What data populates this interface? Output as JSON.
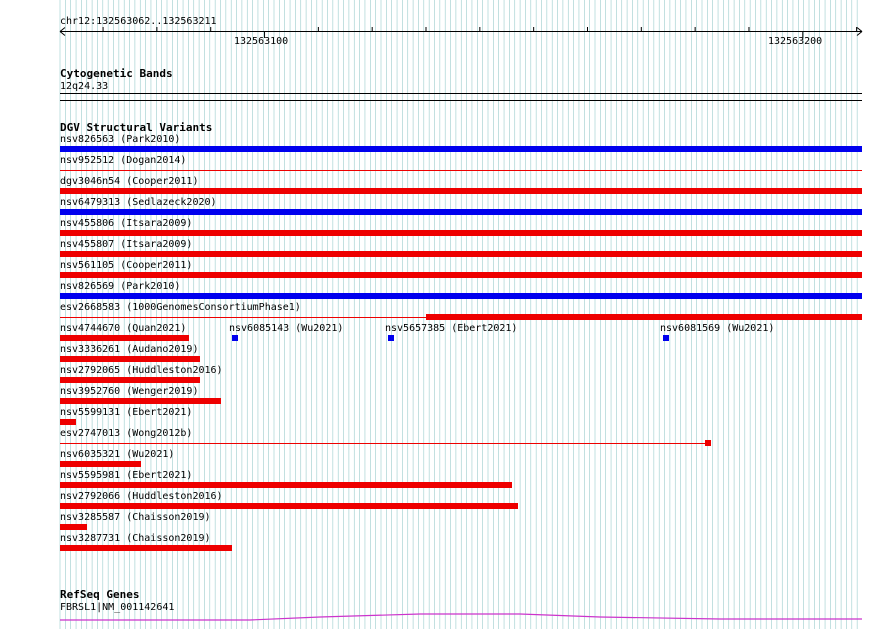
{
  "ruler": {
    "location": "chr12:132563062..132563211",
    "ticks": [
      "132563100",
      "132563200"
    ],
    "start": 132563062,
    "end": 132563211
  },
  "tracks": {
    "cytoband": {
      "title": "Cytogenetic Bands",
      "band": "12q24.33"
    },
    "dgv": {
      "title": "DGV Structural Variants"
    },
    "refseq": {
      "title": "RefSeq Genes",
      "gene": "FBRSL1|NM_001142641"
    }
  },
  "colors": {
    "gain": "#0000ee",
    "loss": "#ee0000",
    "grid": "#99cccc",
    "gene": "#cc33cc"
  },
  "variants": [
    {
      "id": "nsv826563",
      "label": "nsv826563 (Park2010)",
      "color": "gain",
      "start": 132563062,
      "end": 132563211,
      "style": "thick"
    },
    {
      "id": "nsv952512",
      "label": "nsv952512 (Dogan2014)",
      "color": "loss",
      "start": 132563062,
      "end": 132563211,
      "style": "thin"
    },
    {
      "id": "dgv3046n54",
      "label": "dgv3046n54 (Cooper2011)",
      "color": "loss",
      "start": 132563062,
      "end": 132563211,
      "style": "thick"
    },
    {
      "id": "nsv6479313",
      "label": "nsv6479313 (Sedlazeck2020)",
      "color": "gain",
      "start": 132563062,
      "end": 132563211,
      "style": "thick"
    },
    {
      "id": "nsv455806",
      "label": "nsv455806 (Itsara2009)",
      "color": "loss",
      "start": 132563062,
      "end": 132563211,
      "style": "thick"
    },
    {
      "id": "nsv455807",
      "label": "nsv455807 (Itsara2009)",
      "color": "loss",
      "start": 132563062,
      "end": 132563211,
      "style": "thick"
    },
    {
      "id": "nsv561105",
      "label": "nsv561105 (Cooper2011)",
      "color": "loss",
      "start": 132563062,
      "end": 132563211,
      "style": "thick"
    },
    {
      "id": "nsv826569",
      "label": "nsv826569 (Park2010)",
      "color": "gain",
      "start": 132563062,
      "end": 132563211,
      "style": "thick"
    },
    {
      "id": "esv2668583",
      "label": "esv2668583 (1000GenomesConsortiumPhase1)",
      "color": "loss",
      "start": 132563062,
      "end": 132563211,
      "style": "thin-then-thick",
      "thick_start": 132563130
    },
    {
      "id": "nsv4744670",
      "label": "nsv4744670 (Quan2021)",
      "color": "loss",
      "start": 132563062,
      "end": 132563086,
      "style": "thick"
    },
    {
      "id": "nsv6085143",
      "label": "nsv6085143 (Wu2021)",
      "color": "gain",
      "start": 132563094,
      "end": 132563095,
      "style": "dot"
    },
    {
      "id": "nsv5657385",
      "label": "nsv5657385 (Ebert2021)",
      "color": "gain",
      "start": 132563123,
      "end": 132563124,
      "style": "dot"
    },
    {
      "id": "nsv6081569",
      "label": "nsv6081569 (Wu2021)",
      "color": "gain",
      "start": 132563174,
      "end": 132563175,
      "style": "dot"
    },
    {
      "id": "nsv3336261",
      "label": "nsv3336261 (Audano2019)",
      "color": "loss",
      "start": 132563062,
      "end": 132563088,
      "style": "thick"
    },
    {
      "id": "nsv2792065",
      "label": "nsv2792065 (Huddleston2016)",
      "color": "loss",
      "start": 132563062,
      "end": 132563088,
      "style": "thick"
    },
    {
      "id": "nsv3952760",
      "label": "nsv3952760 (Wenger2019)",
      "color": "loss",
      "start": 132563062,
      "end": 132563092,
      "style": "thick"
    },
    {
      "id": "nsv5599131",
      "label": "nsv5599131 (Ebert2021)",
      "color": "loss",
      "start": 132563062,
      "end": 132563065,
      "style": "thick"
    },
    {
      "id": "esv2747013",
      "label": "esv2747013 (Wong2012b)",
      "color": "loss",
      "start": 132563062,
      "end": 132563183,
      "style": "thin-end-block"
    },
    {
      "id": "nsv6035321",
      "label": "nsv6035321 (Wu2021)",
      "color": "loss",
      "start": 132563062,
      "end": 132563077,
      "style": "thick"
    },
    {
      "id": "nsv5595981",
      "label": "nsv5595981 (Ebert2021)",
      "color": "loss",
      "start": 132563062,
      "end": 132563146,
      "style": "thick"
    },
    {
      "id": "nsv2792066",
      "label": "nsv2792066 (Huddleston2016)",
      "color": "loss",
      "start": 132563062,
      "end": 132563147,
      "style": "thick"
    },
    {
      "id": "nsv3285587",
      "label": "nsv3285587 (Chaisson2019)",
      "color": "loss",
      "start": 132563062,
      "end": 132563067,
      "style": "thick"
    },
    {
      "id": "nsv3287731",
      "label": "nsv3287731 (Chaisson2019)",
      "color": "loss",
      "start": 132563062,
      "end": 132563094,
      "style": "thick"
    }
  ]
}
